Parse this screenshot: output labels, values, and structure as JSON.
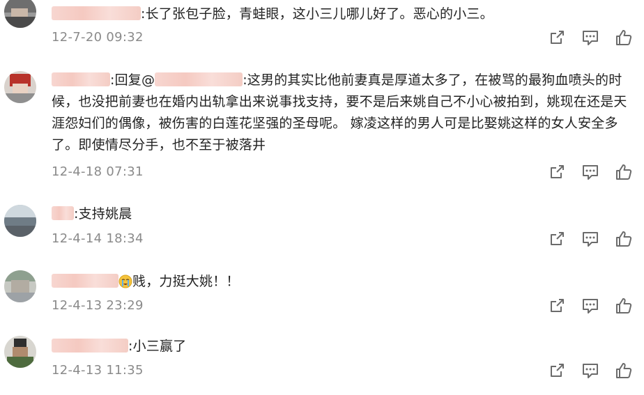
{
  "comments": [
    {
      "text": ":长了张包子脸，青蛙眼，这小三儿哪儿好了。恶心的小三。",
      "time": "12-7-20 09:32"
    },
    {
      "reply_prefix": ":回复@",
      "text": ":这男的其实比他前妻真是厚道太多了，在被骂的最狗血喷头的时候，也没把前妻也在婚内出轨拿出来说事找支持，要不是后来姚自己不小心被拍到，姚现在还是天涯怨妇们的偶像，被伤害的白莲花坚强的圣母呢。 嫁凌这样的男人可是比娶姚这样的女人安全多了。即使情尽分手，也不至于被落井",
      "time": "12-4-18 07:31"
    },
    {
      "text": ":支持姚晨",
      "time": "12-4-14 18:34"
    },
    {
      "emoji": "crying-face",
      "text": "贱，力挺大姚！！",
      "time": "12-4-13 23:29"
    },
    {
      "text": ":小三赢了",
      "time": "12-4-13 11:35"
    }
  ],
  "icons": {
    "share": "share-icon",
    "comment": "comment-icon",
    "like": "like-icon"
  },
  "colors": {
    "text": "#222222",
    "meta": "#8a8a8a",
    "icon": "#6b6b6b",
    "blur": "#f3c0b6"
  }
}
